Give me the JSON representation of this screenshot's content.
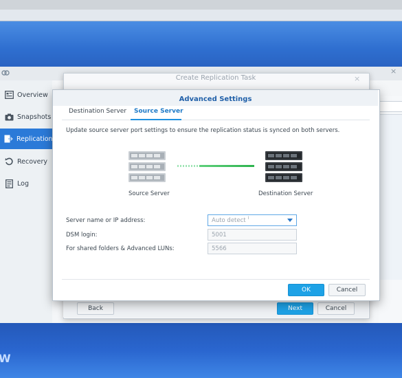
{
  "app": {
    "nav": [
      {
        "label": "Overview",
        "icon": "overview-icon"
      },
      {
        "label": "Snapshots",
        "icon": "camera-icon"
      },
      {
        "label": "Replication",
        "icon": "replication-icon"
      },
      {
        "label": "Recovery",
        "icon": "recovery-icon"
      },
      {
        "label": "Log",
        "icon": "log-icon"
      }
    ],
    "active_nav": "Replication"
  },
  "wizard": {
    "title": "Create Replication Task",
    "back_label": "Back",
    "next_label": "Next",
    "cancel_label": "Cancel"
  },
  "modal": {
    "title": "Advanced Settings",
    "tabs": [
      "Destination Server",
      "Source Server"
    ],
    "active_tab": "Source Server",
    "description": "Update source server port settings to ensure the replication status is synced on both servers.",
    "source_label": "Source Server",
    "destination_label": "Destination Server",
    "fields": {
      "server_name_label": "Server name or IP address:",
      "server_name_value": "Auto detect",
      "dsm_login_label": "DSM login:",
      "dsm_login_value": "5001",
      "shared_label": "For shared folders & Advanced LUNs:",
      "shared_value": "5566"
    },
    "ok_label": "OK",
    "cancel_label": "Cancel"
  },
  "desktop": {
    "corner_text": "W"
  },
  "colors": {
    "accent": "#1ea2e6",
    "active_nav": "#2b7ad8",
    "link": "#2db34e"
  }
}
